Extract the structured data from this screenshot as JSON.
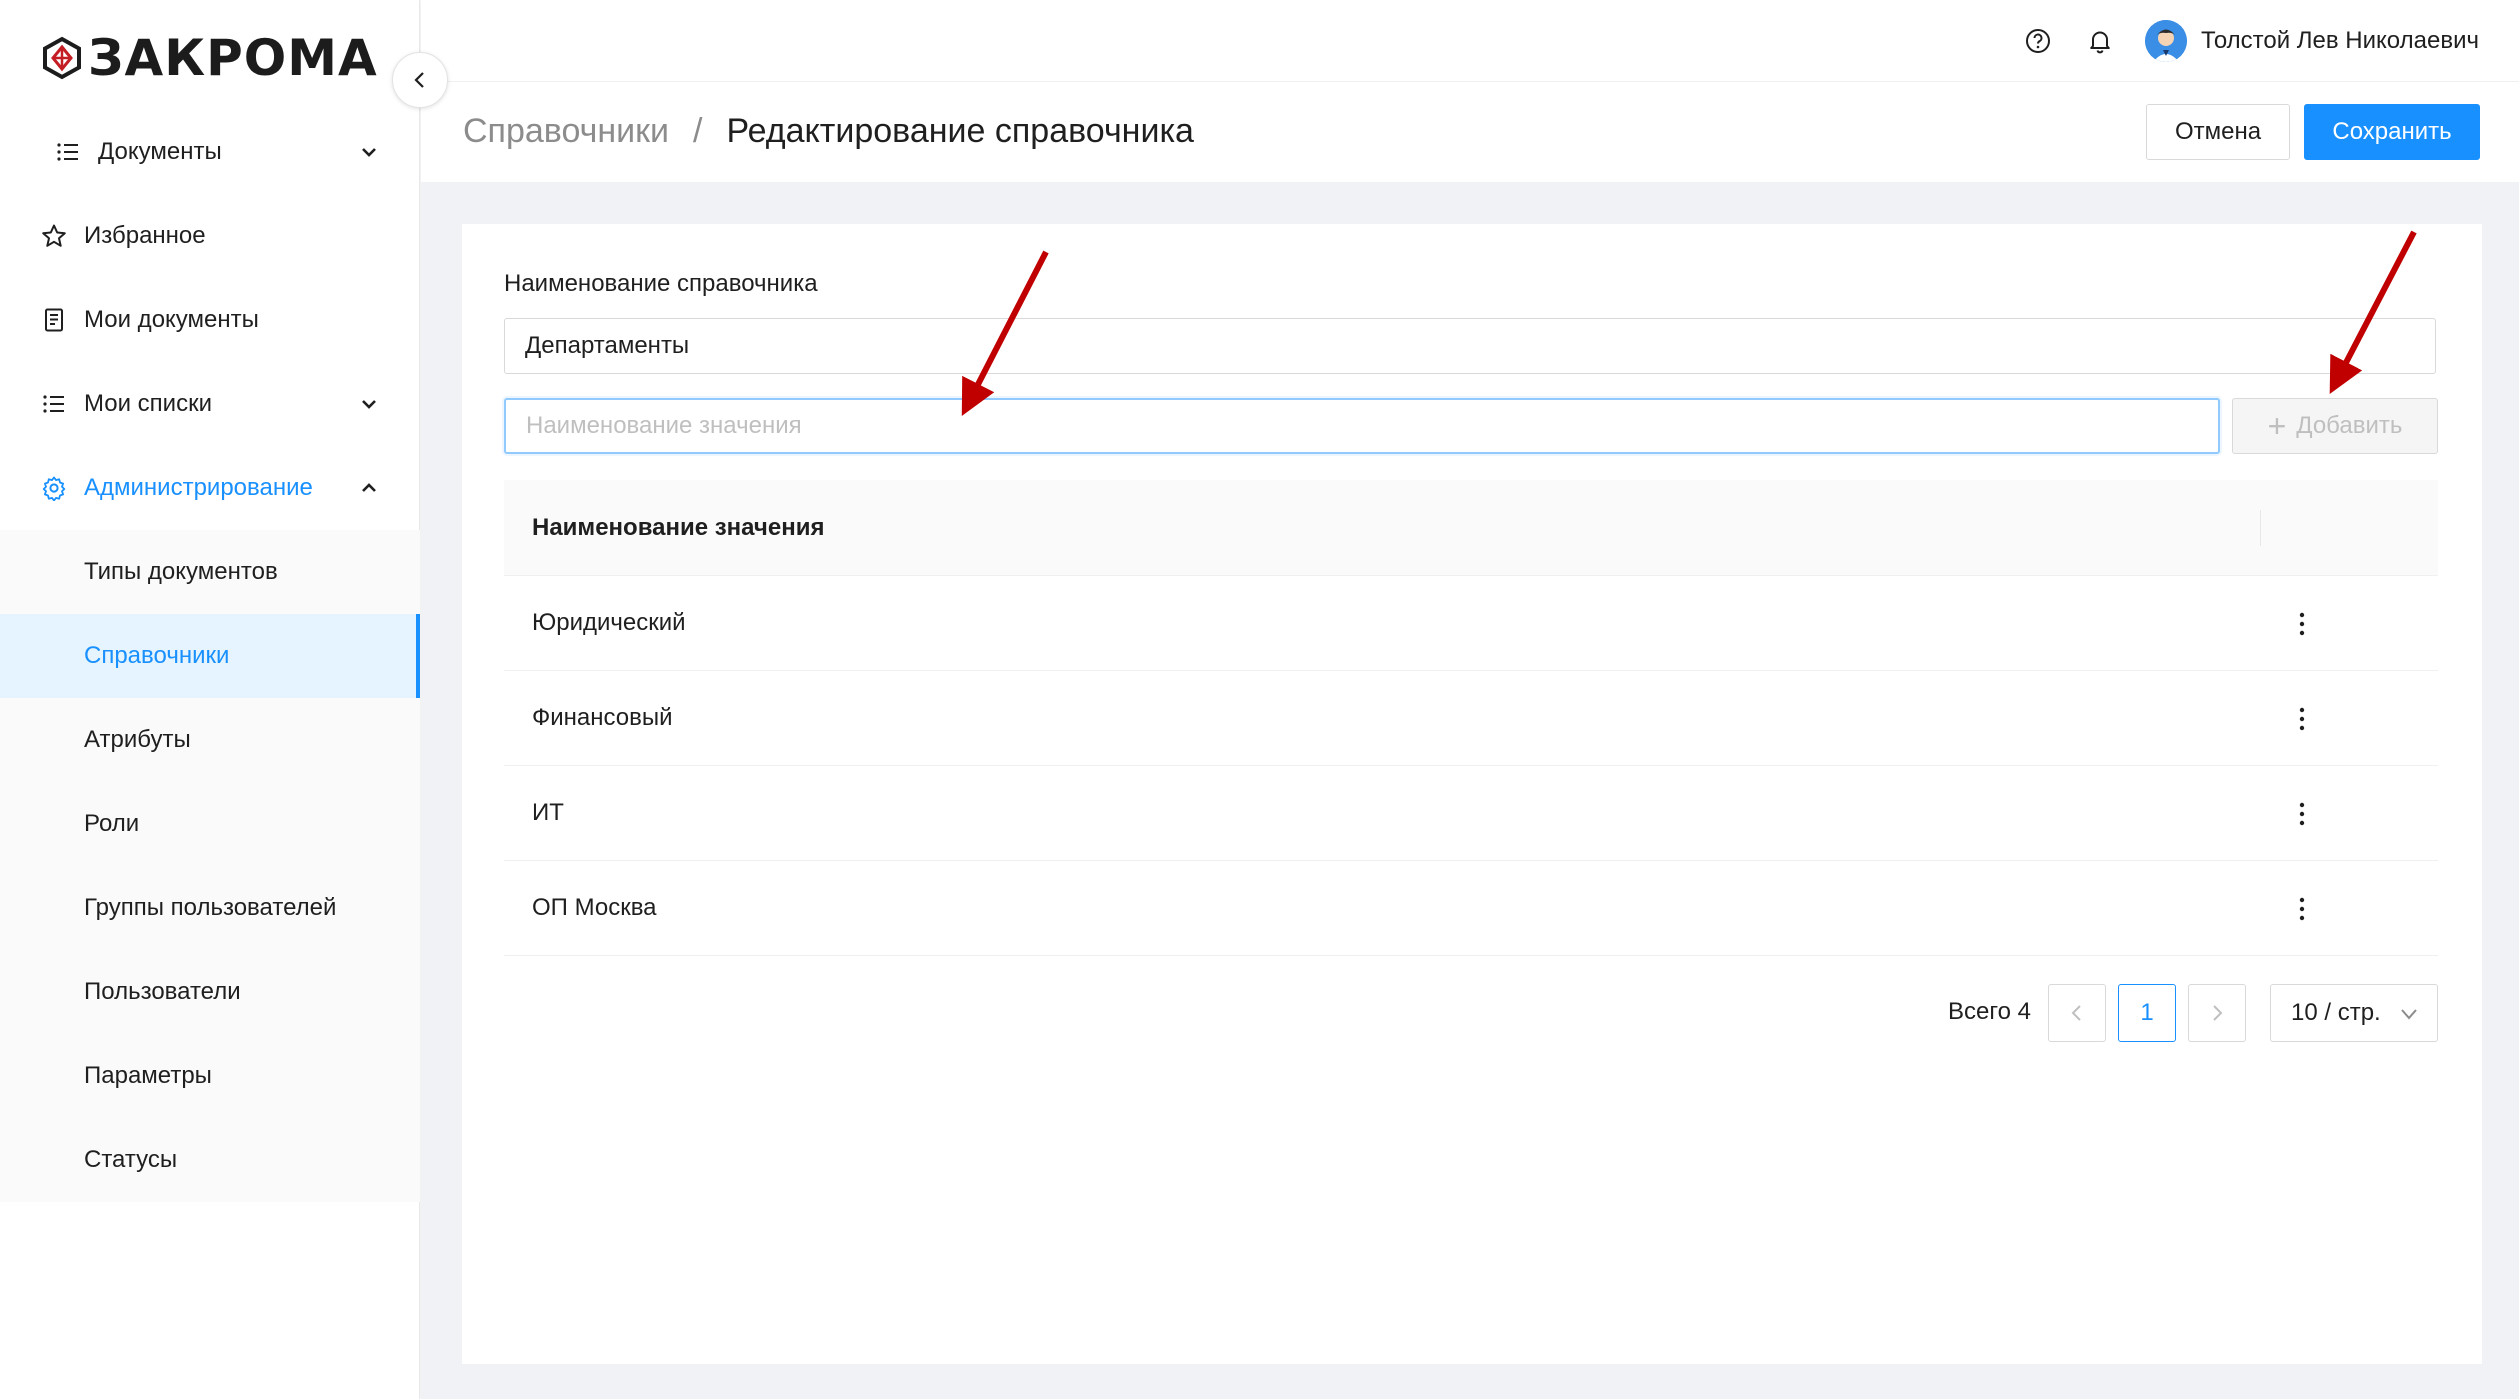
{
  "app": {
    "logo_text": "ЗАКРОМА",
    "accent_color": "#1890ff",
    "logo_accent_color": "#c41e24"
  },
  "sidebar": {
    "items": [
      {
        "label": "Документы",
        "icon": "list-icon",
        "expandable": true,
        "expanded": false
      },
      {
        "label": "Избранное",
        "icon": "star-icon"
      },
      {
        "label": "Мои документы",
        "icon": "document-icon"
      },
      {
        "label": "Мои списки",
        "icon": "list-icon",
        "expandable": true,
        "expanded": false
      },
      {
        "label": "Администрирование",
        "icon": "gear-icon",
        "expandable": true,
        "expanded": true,
        "active": true
      }
    ],
    "admin_submenu": [
      {
        "label": "Типы документов"
      },
      {
        "label": "Справочники",
        "selected": true
      },
      {
        "label": "Атрибуты"
      },
      {
        "label": "Роли"
      },
      {
        "label": "Группы пользователей"
      },
      {
        "label": "Пользователи"
      },
      {
        "label": "Параметры"
      },
      {
        "label": "Статусы"
      }
    ]
  },
  "header": {
    "user_name": "Толстой Лев Николаевич",
    "icons": [
      "help-icon",
      "bell-icon",
      "avatar"
    ]
  },
  "page": {
    "breadcrumb_parent": "Справочники",
    "breadcrumb_separator": "/",
    "breadcrumb_current": "Редактирование справочника",
    "cancel_label": "Отмена",
    "save_label": "Сохранить"
  },
  "form": {
    "name_label": "Наименование справочника",
    "name_value": "Департаменты",
    "value_placeholder": "Наименование значения",
    "value_current": "",
    "add_label": "Добавить"
  },
  "table": {
    "column_header": "Наименование значения",
    "rows": [
      {
        "name": "Юридический"
      },
      {
        "name": "Финансовый"
      },
      {
        "name": "ИТ"
      },
      {
        "name": "ОП Москва"
      }
    ]
  },
  "pagination": {
    "total_label": "Всего 4",
    "current_page": "1",
    "page_size_label": "10 / стр."
  },
  "annotations": {
    "arrow_color": "#c00000"
  }
}
